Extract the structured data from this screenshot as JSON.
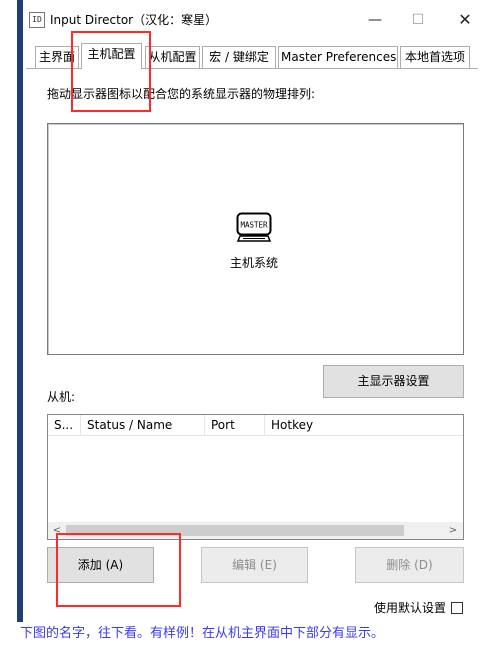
{
  "window": {
    "logo_text": "ID",
    "title": "Input Director（汉化：寒星）",
    "min_glyph": "—",
    "max_glyph": "☐",
    "close_glyph": "✕"
  },
  "tabs": [
    {
      "label": "主界面"
    },
    {
      "label": "主机配置"
    },
    {
      "label": "从机配置"
    },
    {
      "label": "宏 / 键绑定"
    },
    {
      "label": "Master Preferences"
    },
    {
      "label": "本地首选项"
    }
  ],
  "host_config": {
    "instruction": "拖动显示器图标以配合您的系统显示器的物理排列:",
    "monitor_label": "MASTER",
    "host_label": "主机系统",
    "primary_display_button": "主显示器设置",
    "slaves_label": "从机:",
    "columns": [
      "S...",
      "Status / Name",
      "Port",
      "Hotkey"
    ],
    "rows": [],
    "scroll_left": "<",
    "scroll_right": ">",
    "buttons": {
      "add": "添加 (A)",
      "edit": "编辑 (E)",
      "delete": "删除 (D)"
    },
    "default_settings_label": "使用默认设置"
  },
  "annotation": {
    "color": "#ff2a2a",
    "note": "下图的名字，往下看。有样例！在从机主界面中下部分有显示。",
    "note_color": "#3a3af0"
  }
}
